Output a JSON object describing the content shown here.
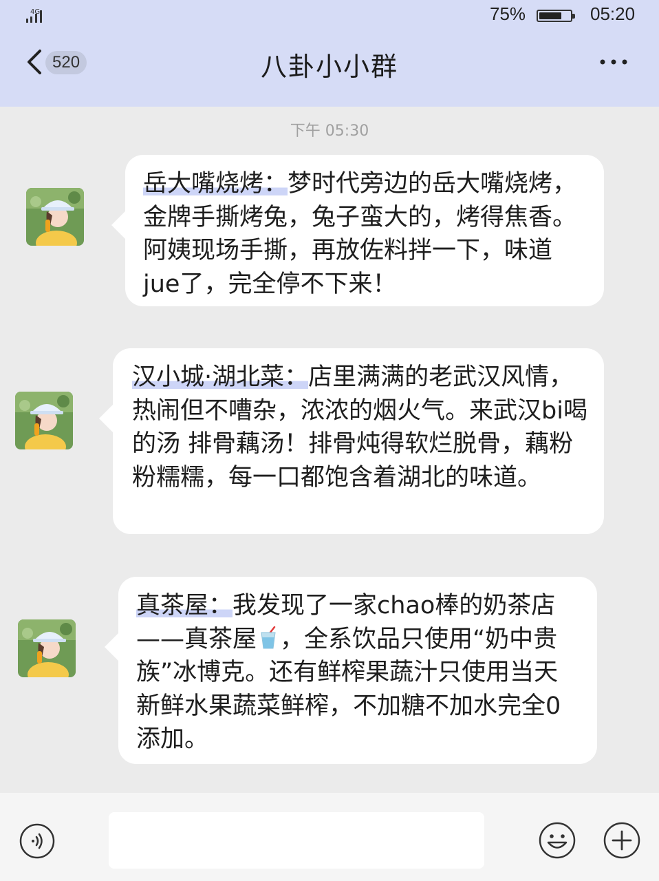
{
  "status_bar": {
    "network": "4G",
    "battery_percent": "75%",
    "battery_level": 0.75,
    "time": "05:20",
    "icons": [
      "signal-icon",
      "battery-icon"
    ]
  },
  "header": {
    "back_icon": "chevron-left-icon",
    "unread_count": "520",
    "title": "八卦小小群",
    "more_icon": "more-dots-icon"
  },
  "chat": {
    "timestamp": "下午 05:30",
    "messages": [
      {
        "avatar_icon": "avatar",
        "label": "岳大嘴烧烤：",
        "text": "梦时代旁边的岳大嘴烧烤，金牌手撕烤兔，兔子蛮大的，烤得焦香。阿姨现场手撕，再放佐料拌一下，味道jue了，完全停不下来！"
      },
      {
        "avatar_icon": "avatar",
        "label": "汉小城·湖北菜：",
        "text": "店里满满的老武汉风情，热闹但不嘈杂，浓浓的烟火气。来武汉bi喝的汤 排骨藕汤！排骨炖得软烂脱骨，藕粉粉糯糯，每一口都饱含着湖北的味道。"
      },
      {
        "avatar_icon": "avatar",
        "label": "真茶屋：",
        "text_before": "我发现了一家chao棒的奶茶店——真茶屋",
        "emoji": "cup-with-straw-icon",
        "text_after": "，全系饮品只使用“奶中贵族”冰博克。还有鲜榨果蔬汁只使用当天新鲜水果蔬菜鲜榨，不加糖不加水完全0添加。"
      }
    ]
  },
  "input_bar": {
    "voice_icon": "voice-icon",
    "input_value": "",
    "emoji_icon": "smiley-icon",
    "plus_icon": "plus-icon"
  },
  "colors": {
    "header_bg": "#d6dcf6",
    "chat_bg": "#ebebeb",
    "bubble_bg": "#ffffff",
    "label_highlight": "#cdd5f7",
    "bottom_bar_bg": "#f5f5f5"
  }
}
